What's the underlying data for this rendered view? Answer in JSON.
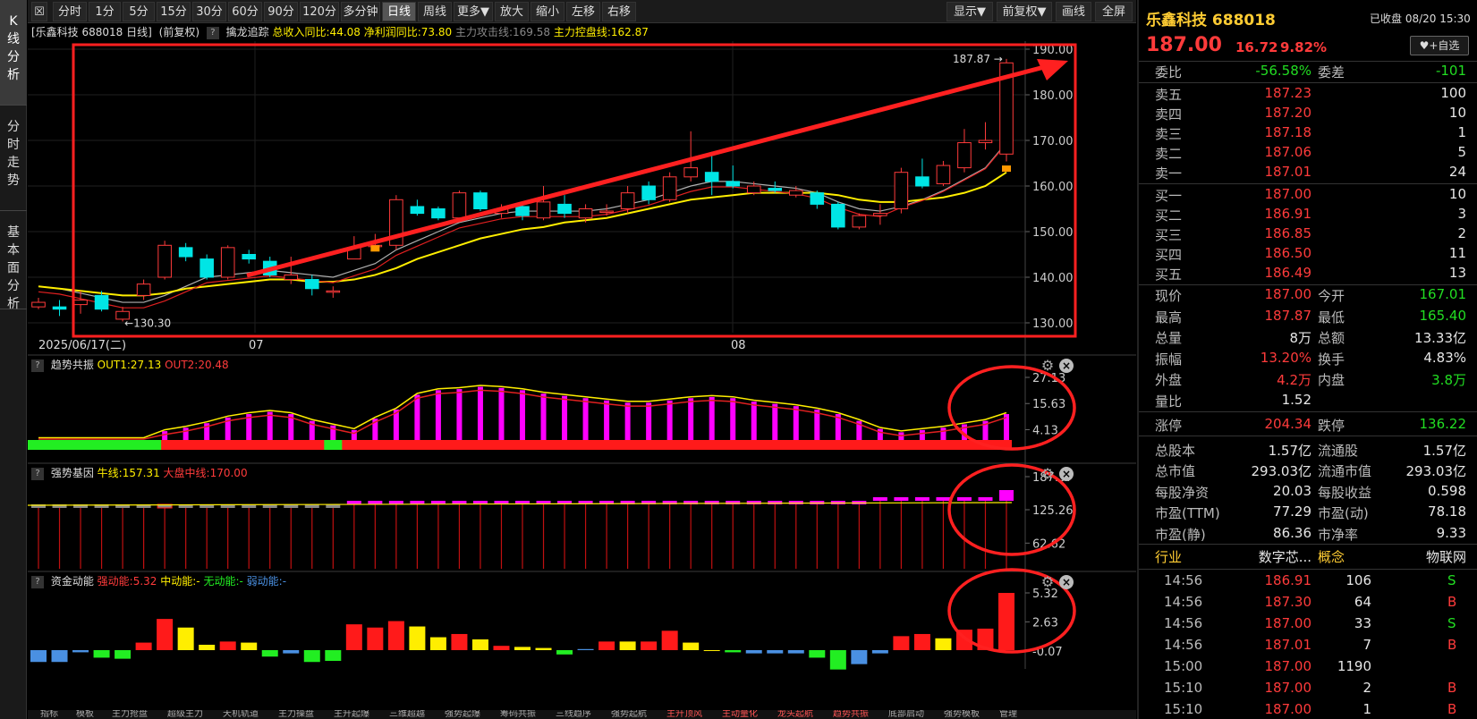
{
  "left_tabs": [
    {
      "label": "K\n线\n分\n析",
      "active": true
    },
    {
      "label": "分\n时\n走\n势",
      "active": false
    },
    {
      "label": "基\n本\n面\n分\n析",
      "active": false
    }
  ],
  "toolbar": {
    "buttons": [
      "分时",
      "1分",
      "5分",
      "15分",
      "30分",
      "60分",
      "90分",
      "120分",
      "多分钟",
      "日线",
      "周线",
      "更多▼",
      "放大",
      "缩小",
      "左移",
      "右移"
    ],
    "active": "日线",
    "right_buttons": [
      "显示▼",
      "前复权▼",
      "画线",
      "全屏"
    ]
  },
  "infobar": {
    "title": "[乐鑫科技 688018 日线]",
    "fq": "(前复权)",
    "indicator": "擒龙追踪",
    "rev_label": "总收入同比:44.08",
    "profit_label": "净利润同比:73.80",
    "attack_label": "主力攻击线:169.58",
    "control_label": "主力控盘线:162.87"
  },
  "main_chart": {
    "y_ticks": [
      "190.00",
      "180.00",
      "170.00",
      "160.00",
      "150.00",
      "140.00",
      "130.00"
    ],
    "date_label": "2025/06/17(二)",
    "month_labels": [
      "07",
      "08"
    ],
    "high_label": "187.87",
    "low_label": "130.30"
  },
  "chart_data": [
    {
      "type": "candlestick",
      "title": "乐鑫科技 688018 日线",
      "ylim": [
        127,
        192
      ],
      "candles": [
        {
          "o": 133.5,
          "c": 134.5,
          "h": 135.5,
          "l": 133
        },
        {
          "o": 133.5,
          "c": 133.0,
          "h": 135,
          "l": 131.5
        },
        {
          "o": 134,
          "c": 135,
          "h": 137,
          "l": 132
        },
        {
          "o": 136,
          "c": 133,
          "h": 137,
          "l": 132.5
        },
        {
          "o": 130.8,
          "c": 132.5,
          "h": 133.5,
          "l": 130.3
        },
        {
          "o": 136,
          "c": 138.5,
          "h": 139.5,
          "l": 135
        },
        {
          "o": 140,
          "c": 147,
          "h": 148,
          "l": 139.5
        },
        {
          "o": 146.5,
          "c": 144.5,
          "h": 147.5,
          "l": 143.5
        },
        {
          "o": 144,
          "c": 140,
          "h": 145,
          "l": 139.5
        },
        {
          "o": 140,
          "c": 146.5,
          "h": 147,
          "l": 139.5
        },
        {
          "o": 145,
          "c": 144,
          "h": 146,
          "l": 143
        },
        {
          "o": 143.5,
          "c": 140.5,
          "h": 144.5,
          "l": 140
        },
        {
          "o": 139.5,
          "c": 140.5,
          "h": 144.5,
          "l": 138.5
        },
        {
          "o": 139.5,
          "c": 137.5,
          "h": 140.5,
          "l": 136
        },
        {
          "o": 137,
          "c": 137,
          "h": 138,
          "l": 135.5
        },
        {
          "o": 144,
          "c": 146.5,
          "h": 149,
          "l": 144
        },
        {
          "o": 147,
          "c": 147,
          "h": 149.5,
          "l": 146
        },
        {
          "o": 147,
          "c": 157,
          "h": 158,
          "l": 146
        },
        {
          "o": 155.5,
          "c": 154,
          "h": 157,
          "l": 153.5
        },
        {
          "o": 155,
          "c": 153,
          "h": 155.5,
          "l": 152.5
        },
        {
          "o": 153,
          "c": 158.5,
          "h": 159,
          "l": 152.5
        },
        {
          "o": 158.5,
          "c": 155,
          "h": 159,
          "l": 154.5
        },
        {
          "o": 154,
          "c": 155,
          "h": 156,
          "l": 153
        },
        {
          "o": 155.5,
          "c": 153.5,
          "h": 156.5,
          "l": 152.5
        },
        {
          "o": 153,
          "c": 156.5,
          "h": 160,
          "l": 152.5
        },
        {
          "o": 156,
          "c": 154,
          "h": 158,
          "l": 153
        },
        {
          "o": 153,
          "c": 155,
          "h": 156,
          "l": 152
        },
        {
          "o": 154.5,
          "c": 154.5,
          "h": 156,
          "l": 153.5
        },
        {
          "o": 155,
          "c": 158.5,
          "h": 160,
          "l": 154
        },
        {
          "o": 160,
          "c": 157,
          "h": 161,
          "l": 156
        },
        {
          "o": 157,
          "c": 162,
          "h": 163,
          "l": 156.5
        },
        {
          "o": 162,
          "c": 164,
          "h": 172,
          "l": 161
        },
        {
          "o": 163,
          "c": 161,
          "h": 167.5,
          "l": 158
        },
        {
          "o": 161,
          "c": 160,
          "h": 164.5,
          "l": 159.5
        },
        {
          "o": 158.5,
          "c": 160,
          "h": 161,
          "l": 158
        },
        {
          "o": 159.5,
          "c": 159,
          "h": 161,
          "l": 158.5
        },
        {
          "o": 158,
          "c": 159,
          "h": 160,
          "l": 157.5
        },
        {
          "o": 158.5,
          "c": 156,
          "h": 159,
          "l": 155
        },
        {
          "o": 156,
          "c": 151,
          "h": 156.5,
          "l": 150.5
        },
        {
          "o": 151,
          "c": 153.5,
          "h": 154,
          "l": 150.5
        },
        {
          "o": 153.5,
          "c": 154,
          "h": 156,
          "l": 151.5
        },
        {
          "o": 155,
          "c": 163,
          "h": 164,
          "l": 154
        },
        {
          "o": 162,
          "c": 160,
          "h": 166,
          "l": 159.5
        },
        {
          "o": 160.5,
          "c": 164.5,
          "h": 165.5,
          "l": 160
        },
        {
          "o": 164,
          "c": 169.5,
          "h": 172.5,
          "l": 163
        },
        {
          "o": 169.5,
          "c": 170,
          "h": 174,
          "l": 168
        },
        {
          "o": 167,
          "c": 187,
          "h": 187.87,
          "l": 165.4
        }
      ],
      "ma_short": [
        138,
        137.5,
        136.5,
        135.5,
        134.5,
        134.5,
        136,
        138,
        140,
        140.5,
        141,
        141.5,
        141,
        140.5,
        140,
        141.5,
        143,
        146,
        148,
        150,
        152,
        153,
        154,
        154.5,
        154.5,
        154.5,
        154.5,
        155,
        156,
        157,
        158.5,
        160,
        161,
        161,
        160.5,
        160,
        159.5,
        158.5,
        156.5,
        155,
        154.5,
        155.5,
        157,
        159,
        161.5,
        164,
        169.5
      ],
      "ma_long": [
        138,
        137.5,
        137,
        136.5,
        136,
        136,
        136.5,
        137.5,
        138,
        138.5,
        139,
        139.5,
        139.5,
        139,
        139,
        139.5,
        140.5,
        142,
        144,
        145.5,
        147,
        148.5,
        149.5,
        150.5,
        151,
        152,
        152.5,
        153,
        154,
        155,
        156,
        157,
        157.5,
        158,
        158.5,
        158.5,
        158.5,
        158.5,
        158,
        157,
        156.5,
        156.5,
        157,
        157.5,
        158.5,
        160,
        163
      ]
    },
    {
      "type": "bar",
      "title": "趋势共振",
      "series": [
        {
          "name": "OUT1",
          "last": 27.13
        },
        {
          "name": "OUT2",
          "last": 20.48
        }
      ],
      "y_ticks": [
        "27.13",
        "15.63",
        "4.13"
      ],
      "bars": [
        0,
        0,
        0,
        0,
        0,
        0,
        3.5,
        5,
        7,
        9.5,
        11,
        12,
        11,
        8,
        6,
        4,
        9,
        13,
        19.5,
        21.5,
        22,
        23,
        22.5,
        21.5,
        20,
        19,
        18,
        17,
        16,
        16,
        17,
        18,
        18.5,
        18,
        16.5,
        15.5,
        14.5,
        13,
        11,
        8,
        4.5,
        3,
        4,
        5,
        6.5,
        8,
        11,
        15,
        27.13
      ],
      "zero_band": {
        "green_until": 6,
        "green_at": 14
      }
    },
    {
      "type": "bar",
      "title": "强势基因",
      "series": [
        {
          "name": "牛线",
          "last": 157.31
        },
        {
          "name": "大盘中线",
          "last": 170.0
        }
      ],
      "y_ticks": [
        "187.37",
        "125.26",
        "62.62"
      ]
    },
    {
      "type": "bar",
      "title": "资金动能",
      "series": [
        {
          "name": "强动能",
          "last": 5.32
        },
        {
          "name": "中动能",
          "last": null
        },
        {
          "name": "无动能",
          "last": null
        },
        {
          "name": "弱动能",
          "last": null
        }
      ],
      "y_ticks": [
        "5.32",
        "2.63",
        "-0.07"
      ],
      "bars": [
        {
          "v": -1.1,
          "c": "#4a90e2"
        },
        {
          "v": -1.1,
          "c": "#4a90e2"
        },
        {
          "v": -0.2,
          "c": "#4a90e2"
        },
        {
          "v": -0.7,
          "c": "#22ee22"
        },
        {
          "v": -0.8,
          "c": "#22ee22"
        },
        {
          "v": 0.7,
          "c": "#ff1a1a"
        },
        {
          "v": 2.9,
          "c": "#ff1a1a"
        },
        {
          "v": 2.1,
          "c": "#ffee00"
        },
        {
          "v": 0.5,
          "c": "#ffee00"
        },
        {
          "v": 0.8,
          "c": "#ff1a1a"
        },
        {
          "v": 0.7,
          "c": "#ffee00"
        },
        {
          "v": -0.6,
          "c": "#22ee22"
        },
        {
          "v": -0.3,
          "c": "#4a90e2"
        },
        {
          "v": -1.1,
          "c": "#22ee22"
        },
        {
          "v": -1.0,
          "c": "#22ee22"
        },
        {
          "v": 2.4,
          "c": "#ff1a1a"
        },
        {
          "v": 2.1,
          "c": "#ff1a1a"
        },
        {
          "v": 2.7,
          "c": "#ff1a1a"
        },
        {
          "v": 2.2,
          "c": "#ffee00"
        },
        {
          "v": 1.2,
          "c": "#ffee00"
        },
        {
          "v": 1.5,
          "c": "#ff1a1a"
        },
        {
          "v": 1.0,
          "c": "#ffee00"
        },
        {
          "v": 0.4,
          "c": "#ff1a1a"
        },
        {
          "v": 0.3,
          "c": "#ffee00"
        },
        {
          "v": 0.2,
          "c": "#ffee00"
        },
        {
          "v": -0.4,
          "c": "#22ee22"
        },
        {
          "v": 0.1,
          "c": "#4a90e2"
        },
        {
          "v": 0.8,
          "c": "#ff1a1a"
        },
        {
          "v": 0.8,
          "c": "#ffee00"
        },
        {
          "v": 0.8,
          "c": "#ff1a1a"
        },
        {
          "v": 1.8,
          "c": "#ff1a1a"
        },
        {
          "v": 0.7,
          "c": "#ffee00"
        },
        {
          "v": 0.0,
          "c": "#ffee00"
        },
        {
          "v": -0.2,
          "c": "#22ee22"
        },
        {
          "v": -0.3,
          "c": "#4a90e2"
        },
        {
          "v": -0.3,
          "c": "#4a90e2"
        },
        {
          "v": -0.3,
          "c": "#4a90e2"
        },
        {
          "v": -0.7,
          "c": "#22ee22"
        },
        {
          "v": -1.8,
          "c": "#22ee22"
        },
        {
          "v": -1.3,
          "c": "#4a90e2"
        },
        {
          "v": -0.3,
          "c": "#4a90e2"
        },
        {
          "v": 1.3,
          "c": "#ff1a1a"
        },
        {
          "v": 1.5,
          "c": "#ff1a1a"
        },
        {
          "v": 1.1,
          "c": "#ffee00"
        },
        {
          "v": 1.9,
          "c": "#ff1a1a"
        },
        {
          "v": 2.0,
          "c": "#ff1a1a"
        },
        {
          "v": 5.32,
          "c": "#ff1a1a"
        }
      ]
    }
  ],
  "panes": {
    "trend": {
      "title": "趋势共振",
      "out1": "OUT1:27.13",
      "out2": "OUT2:20.48"
    },
    "strong": {
      "title": "强势基因",
      "bull": "牛线:157.31",
      "mid": "大盘中线:170.00"
    },
    "fund": {
      "title": "资金动能",
      "strong": "强动能:5.32",
      "medium": "中动能:-",
      "none": "无动能:-",
      "weak": "弱动能:-"
    }
  },
  "bottom_tabs": [
    "指标",
    "模板",
    "主力抢盘",
    "超级主力",
    "天机轨道",
    "主力操盘",
    "主升起爆",
    "三维超越",
    "强势起爆",
    "筹码共振",
    "三线趋序",
    "强势起航",
    "主升顶风",
    "主动量化",
    "龙头起航",
    "趋势共振",
    "底部启动",
    "强势模板",
    "管理"
  ],
  "quote": {
    "name": "乐鑫科技 688018",
    "status": "已收盘 08/20 15:30",
    "price": "187.00",
    "change": "16.72",
    "pct": "9.82%",
    "fav": "+自选",
    "weibi_label": "委比",
    "weibi": "-56.58%",
    "weicha_label": "委差",
    "weicha": "-101",
    "asks": [
      {
        "label": "卖五",
        "price": "187.23",
        "vol": "100"
      },
      {
        "label": "卖四",
        "price": "187.20",
        "vol": "10"
      },
      {
        "label": "卖三",
        "price": "187.18",
        "vol": "1"
      },
      {
        "label": "卖二",
        "price": "187.06",
        "vol": "5"
      },
      {
        "label": "卖一",
        "price": "187.01",
        "vol": "24"
      }
    ],
    "bids": [
      {
        "label": "买一",
        "price": "187.00",
        "vol": "10"
      },
      {
        "label": "买二",
        "price": "186.91",
        "vol": "3"
      },
      {
        "label": "买三",
        "price": "186.85",
        "vol": "2"
      },
      {
        "label": "买四",
        "price": "186.50",
        "vol": "11"
      },
      {
        "label": "买五",
        "price": "186.49",
        "vol": "13"
      }
    ],
    "stats": [
      [
        {
          "k": "现价",
          "v": "187.00",
          "c": "red"
        },
        {
          "k": "今开",
          "v": "167.01",
          "c": "green"
        }
      ],
      [
        {
          "k": "最高",
          "v": "187.87",
          "c": "red"
        },
        {
          "k": "最低",
          "v": "165.40",
          "c": "green"
        }
      ],
      [
        {
          "k": "总量",
          "v": "8万",
          "c": "white"
        },
        {
          "k": "总额",
          "v": "13.33亿",
          "c": "white"
        }
      ],
      [
        {
          "k": "振幅",
          "v": "13.20%",
          "c": "red"
        },
        {
          "k": "换手",
          "v": "4.83%",
          "c": "white"
        }
      ],
      [
        {
          "k": "外盘",
          "v": "4.2万",
          "c": "red"
        },
        {
          "k": "内盘",
          "v": "3.8万",
          "c": "green"
        }
      ],
      [
        {
          "k": "量比",
          "v": "1.52",
          "c": "white"
        },
        {
          "k": "",
          "v": "",
          "c": "white"
        }
      ],
      [
        {
          "k": "涨停",
          "v": "204.34",
          "c": "red"
        },
        {
          "k": "跌停",
          "v": "136.22",
          "c": "green"
        }
      ],
      [
        {
          "k": "总股本",
          "v": "1.57亿",
          "c": "white"
        },
        {
          "k": "流通股",
          "v": "1.57亿",
          "c": "white"
        }
      ],
      [
        {
          "k": "总市值",
          "v": "293.03亿",
          "c": "white"
        },
        {
          "k": "流通市值",
          "v": "293.03亿",
          "c": "white"
        }
      ],
      [
        {
          "k": "每股净资",
          "v": "20.03",
          "c": "white"
        },
        {
          "k": "每股收益",
          "v": "0.598",
          "c": "white"
        }
      ],
      [
        {
          "k": "市盈(TTM)",
          "v": "77.29",
          "c": "white"
        },
        {
          "k": "市盈(动)",
          "v": "78.18",
          "c": "white"
        }
      ],
      [
        {
          "k": "市盈(静)",
          "v": "86.36",
          "c": "white"
        },
        {
          "k": "市净率",
          "v": "9.33",
          "c": "white"
        }
      ]
    ],
    "industry_label": "行业",
    "industry": "数字芯...",
    "concept_label": "概念",
    "concept": "物联网",
    "ticks": [
      {
        "t": "14:56",
        "p": "186.91",
        "v": "106",
        "s": "S"
      },
      {
        "t": "14:56",
        "p": "187.30",
        "v": "64",
        "s": "B"
      },
      {
        "t": "14:56",
        "p": "187.00",
        "v": "33",
        "s": "S"
      },
      {
        "t": "14:56",
        "p": "187.01",
        "v": "7",
        "s": "B"
      },
      {
        "t": "15:00",
        "p": "187.00",
        "v": "1190",
        "s": ""
      },
      {
        "t": "15:10",
        "p": "187.00",
        "v": "2",
        "s": "B"
      },
      {
        "t": "15:10",
        "p": "187.00",
        "v": "1",
        "s": "B"
      }
    ]
  },
  "colors": {
    "up": "#ff3b3b",
    "down": "#00e5e5",
    "ma_short": "#b0b0b0",
    "ma_long": "#ffee00",
    "annot": "#ff2020"
  }
}
